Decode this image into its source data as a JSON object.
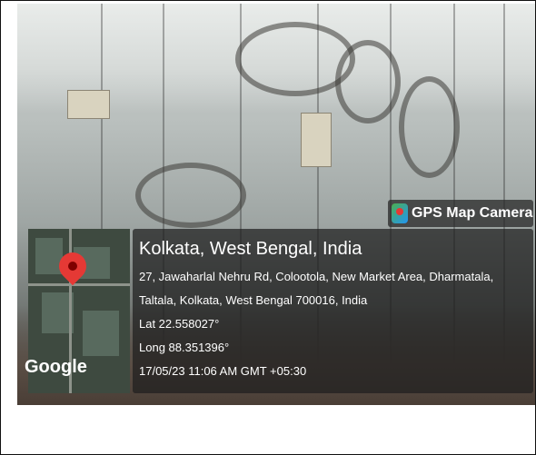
{
  "overlay": {
    "badge_label": "GPS Map Camera",
    "place_title": "Kolkata, West Bengal, India",
    "address_line1": "27, Jawaharlal Nehru Rd, Colootola, New Market Area, Dharmatala,",
    "address_line2": "Taltala, Kolkata, West Bengal 700016, India",
    "latitude": "Lat 22.558027°",
    "longitude": "Long 88.351396°",
    "timestamp": "17/05/23 11:06 AM GMT +05:30",
    "map_brand": "Google"
  },
  "colors": {
    "pin": "#e53935",
    "panel": "#1e1e1e"
  },
  "icons": {
    "badge_icon": "gps-map-camera-icon",
    "pin_icon": "map-pin-icon"
  }
}
